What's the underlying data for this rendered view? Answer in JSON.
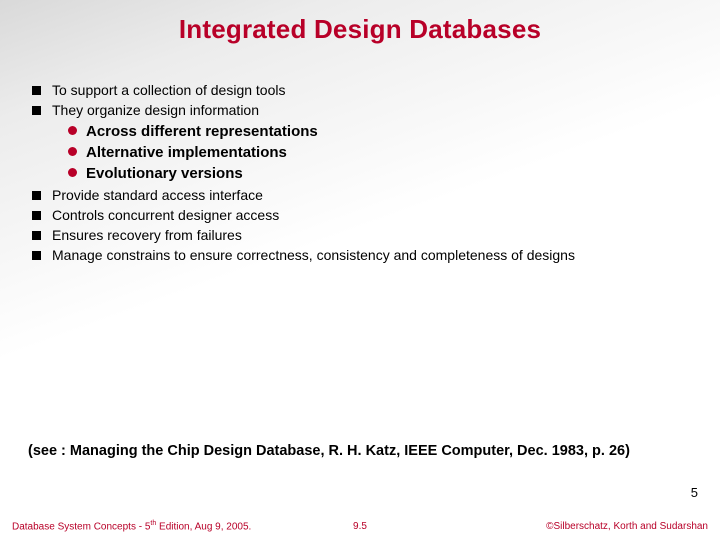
{
  "title": "Integrated Design Databases",
  "bullets_top": [
    "To support a collection of design tools",
    "They organize design information"
  ],
  "sub_bullets": [
    "Across different representations",
    "Alternative implementations",
    "Evolutionary versions"
  ],
  "bullets_bottom": [
    "Provide standard access interface",
    "Controls concurrent designer access",
    "Ensures recovery from failures",
    "Manage constrains to ensure correctness, consistency and completeness of designs"
  ],
  "reference": "(see : Managing the Chip Design Database, R. H. Katz,  IEEE Computer, Dec. 1983, p. 26)",
  "page_count": "5",
  "footer": {
    "left_pre": "Database System Concepts - 5",
    "left_sup": "th",
    "left_post": " Edition, Aug 9, 2005.",
    "center": "9.5",
    "right": "©Silberschatz, Korth and Sudarshan"
  }
}
